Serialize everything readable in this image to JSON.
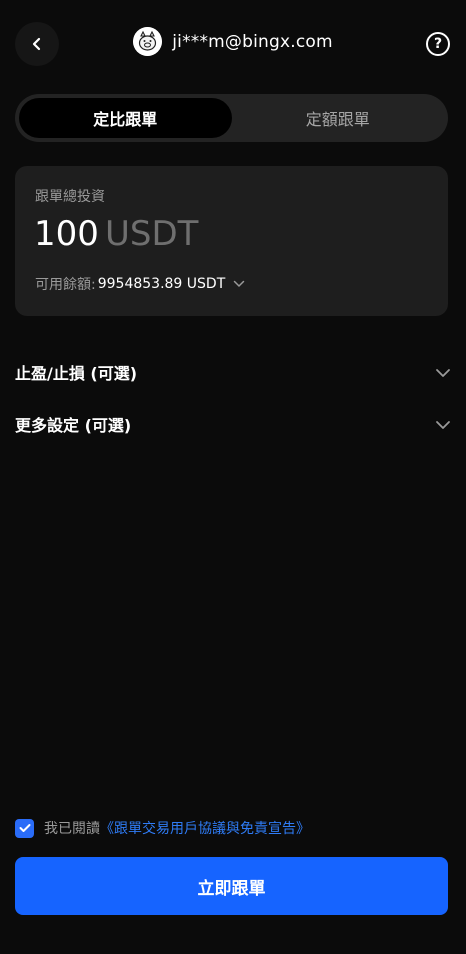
{
  "header": {
    "title": "ji***m@bingx.com",
    "help_glyph": "?",
    "back_icon": "chevron-left-icon",
    "avatar_icon": "pig-avatar-icon"
  },
  "segment": {
    "tabs": [
      {
        "label": "定比跟單",
        "active": true
      },
      {
        "label": "定額跟單",
        "active": false
      }
    ]
  },
  "investment": {
    "label": "跟單總投資",
    "amount": "100",
    "unit": "USDT",
    "available_label": "可用餘額:",
    "available_value": "9954853.89 USDT"
  },
  "sections": {
    "tp_sl": "止盈/止損 (可選)",
    "more_settings": "更多設定 (可選)"
  },
  "agreement": {
    "prefix": "我已閱讀",
    "link": "《跟單交易用戶協議與免責宣告》",
    "checked": true
  },
  "submit": {
    "label": "立即跟單"
  },
  "colors": {
    "background": "#0b0b0b",
    "accent": "#1664ff",
    "link": "#2f7cf6",
    "card": "#1e1e1e"
  }
}
